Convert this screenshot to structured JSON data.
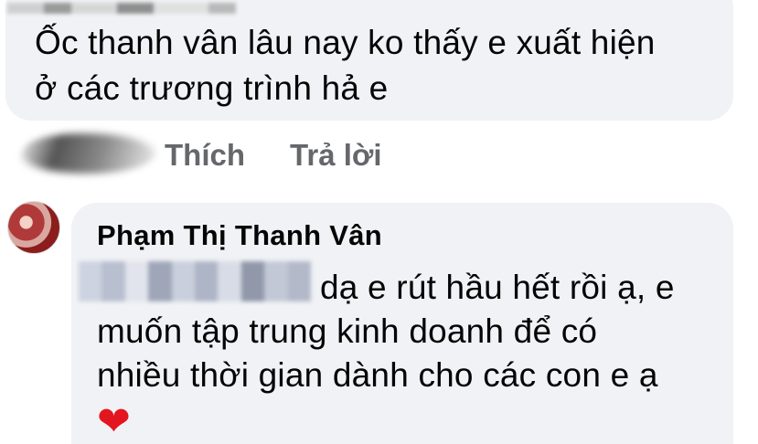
{
  "first_comment": {
    "lines": [
      "Ốc thanh vân lâu nay ko thấy e xuất hiện",
      "ở các trương trình  hả e"
    ]
  },
  "actions": {
    "like_label": "Thích",
    "reply_label": "Trả lời"
  },
  "reply_comment": {
    "author": "Phạm Thị Thanh Vân",
    "lines": [
      "dạ e rút hầu hết rồi ạ, e",
      "muốn tập trung kinh doanh để có",
      "nhiều thời gian dành cho các con e ạ"
    ],
    "emoji": "❤",
    "emoji_icon": "heart-icon"
  },
  "colors": {
    "bubble_bg": "#f0f2f5",
    "action_text": "#65676b",
    "heart": "#e3161f"
  }
}
